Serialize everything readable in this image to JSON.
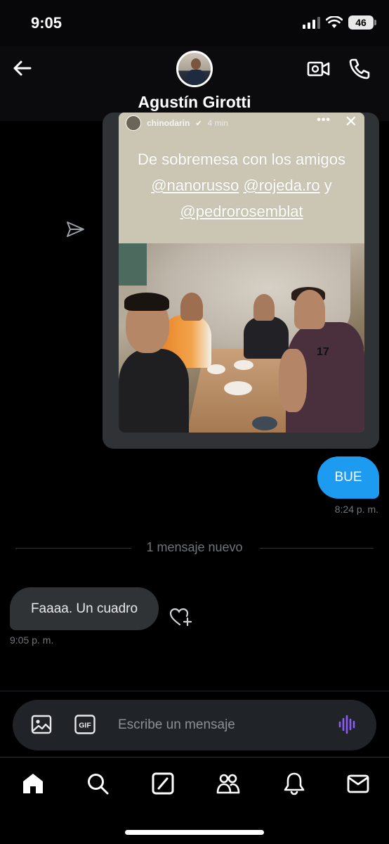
{
  "status_bar": {
    "time": "9:05",
    "battery": "46"
  },
  "header": {
    "contact_name": "Agustín Girotti",
    "back_icon": "arrow-left-icon",
    "video_icon": "video-camera-icon",
    "call_icon": "phone-icon"
  },
  "shared_story": {
    "username": "chinodarin",
    "time_ago": "4 min",
    "caption_line1": "De sobremesa con los amigos",
    "caption_line2_a": "@nanorusso",
    "caption_line2_b": "@rojeda.ro",
    "caption_line2_c": "y",
    "caption_line3": "@pedrorosemblat",
    "shirt_number": "17"
  },
  "messages": {
    "outgoing_text": "BUE",
    "outgoing_time": "8:24 p. m.",
    "new_divider": "1 mensaje nuevo",
    "incoming_text": "Faaaa. Un cuadro",
    "incoming_time": "9:05 p. m."
  },
  "composer": {
    "placeholder": "Escribe un mensaje",
    "gif_label": "GIF",
    "accent": "#8b5cf6"
  },
  "tabs": [
    "home",
    "search",
    "grok",
    "communities",
    "notifications",
    "messages"
  ],
  "colors": {
    "bubble_out": "#1d9bf0",
    "bubble_in": "#2f3336",
    "secondary_text": "#71767b"
  }
}
